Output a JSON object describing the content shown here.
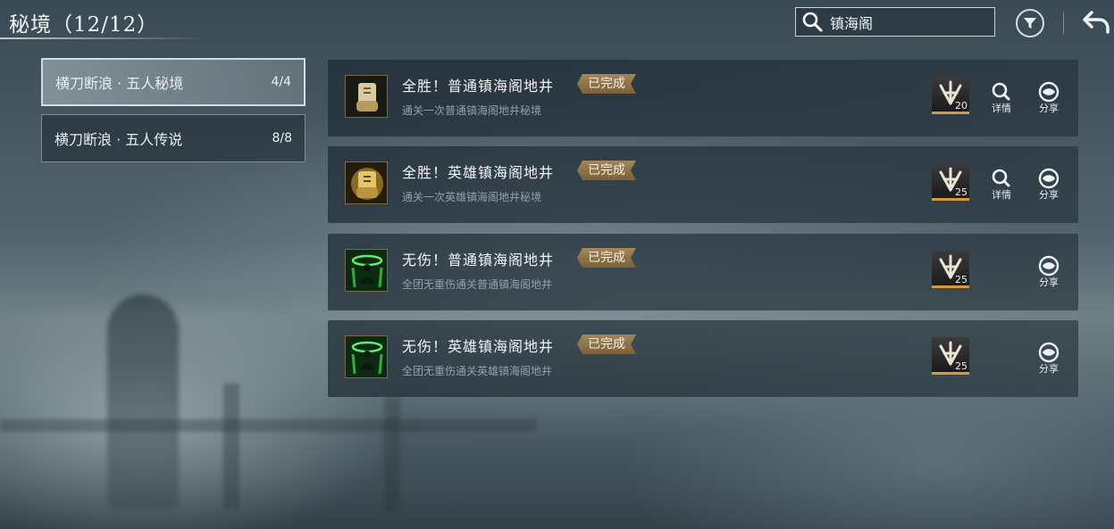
{
  "header": {
    "title": "秘境（12/12）",
    "search_value": "镇海阁"
  },
  "categories": [
    {
      "label": "横刀断浪 · 五人秘境",
      "count": "4/4",
      "active": true
    },
    {
      "label": "横刀断浪 · 五人传说",
      "count": "8/8",
      "active": false
    }
  ],
  "achievements": [
    {
      "title": "全胜！普通镇海阁地井",
      "badge": "已完成",
      "desc": "通关一次普通镇海阁地井秘境",
      "reward": "20",
      "detail_label": "详情",
      "share_label": "分享",
      "icon": "scroll-fist-icon"
    },
    {
      "title": "全胜！英雄镇海阁地井",
      "badge": "已完成",
      "desc": "通关一次英雄镇海阁地井秘境",
      "reward": "25",
      "detail_label": "详情",
      "share_label": "分享",
      "icon": "scroll-fist-icon"
    },
    {
      "title": "无伤！普通镇海阁地井",
      "badge": "已完成",
      "desc": "全团无重伤通关普通镇海阁地井",
      "reward": "25",
      "share_label": "分享",
      "icon": "green-meditation-icon"
    },
    {
      "title": "无伤！英雄镇海阁地井",
      "badge": "已完成",
      "desc": "全团无重伤通关英雄镇海阁地井",
      "reward": "25",
      "share_label": "分享",
      "icon": "green-meditation-icon"
    }
  ],
  "colors": {
    "badge": "#947449",
    "reward_bar": "#d59a3c",
    "accent_green": "#2fae3c"
  }
}
